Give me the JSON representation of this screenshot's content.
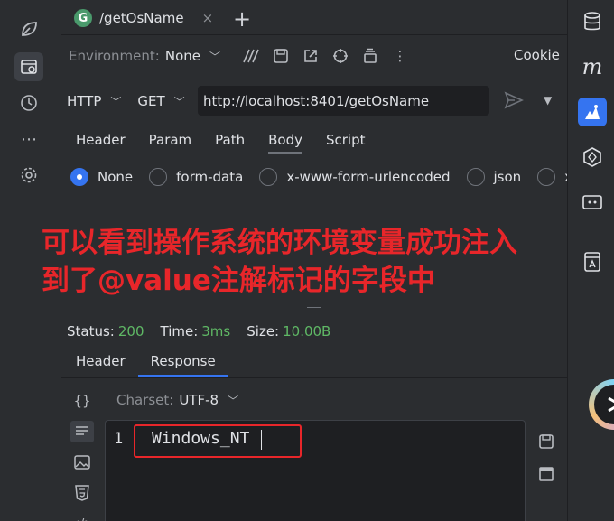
{
  "tab": {
    "badge": "G",
    "title": "/getOsName",
    "close": "×",
    "add": "+"
  },
  "env": {
    "label": "Environment:",
    "value": "None"
  },
  "cookie": "Cookie",
  "request": {
    "protocol": "HTTP",
    "method": "GET",
    "url": "http://localhost:8401/getOsName"
  },
  "sub_tabs": [
    "Header",
    "Param",
    "Path",
    "Body",
    "Script"
  ],
  "body_types": [
    "None",
    "form-data",
    "x-www-form-urlencoded",
    "json",
    "xml"
  ],
  "body_selected": "None",
  "annotation": {
    "line1": "可以看到操作系统的环境变量成功注入",
    "line2": "到了@value注解标记的字段中"
  },
  "status": {
    "status_label": "Status:",
    "status_value": "200",
    "time_label": "Time:",
    "time_value": "3ms",
    "size_label": "Size:",
    "size_value": "10.00B"
  },
  "response_tabs": [
    "Header",
    "Response"
  ],
  "response_active": "Response",
  "charset": {
    "label": "Charset:",
    "value": "UTF-8"
  },
  "editor": {
    "line_number": "1",
    "content": "Windows_NT"
  },
  "colors": {
    "accent": "#3574f0",
    "annotation": "#e8262a",
    "success": "#5fb865"
  }
}
